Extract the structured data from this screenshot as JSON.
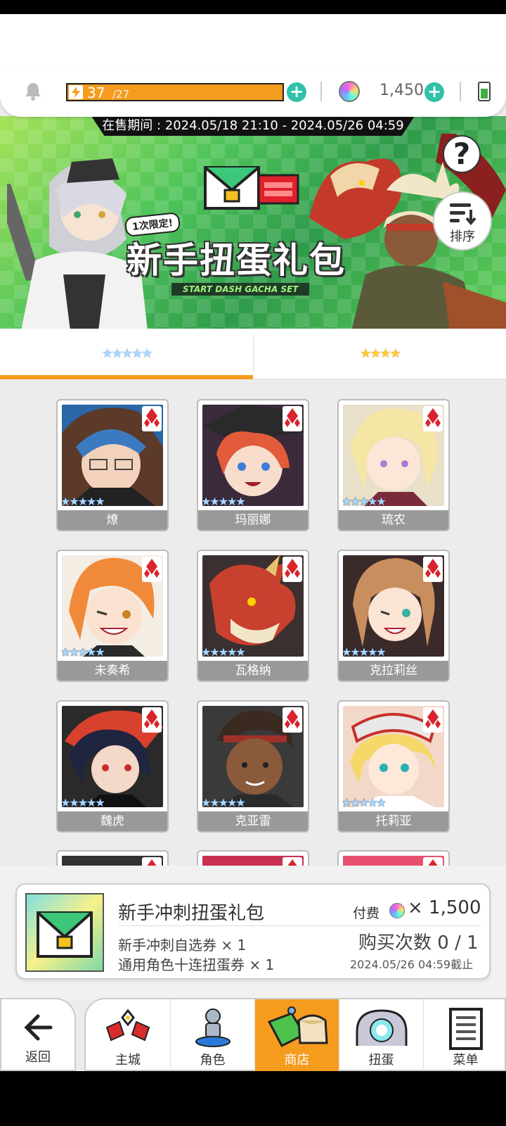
{
  "header": {
    "stamina_current": "37",
    "stamina_max": "/27",
    "gem_count": "1,450"
  },
  "banner": {
    "sale_period": "在售期间 : 2024.05/18 21:10 - 2024.05/26 04:59",
    "limited_tag": "1次限定!",
    "title": "新手扭蛋礼包",
    "subtitle": "START DASH GACHA SET",
    "help_label": "?",
    "sort_label": "排序"
  },
  "tabs": [
    {
      "label": "★★★★★",
      "rarity": 5,
      "selected": true
    },
    {
      "label": "★★★★",
      "rarity": 4,
      "selected": false
    }
  ],
  "characters": [
    {
      "name": "燎",
      "stars": "★★★★★"
    },
    {
      "name": "玛丽娜",
      "stars": "★★★★★"
    },
    {
      "name": "琉农",
      "stars": "★★★★★"
    },
    {
      "name": "未奏希",
      "stars": "★★★★★"
    },
    {
      "name": "瓦格纳",
      "stars": "★★★★★"
    },
    {
      "name": "克拉莉丝",
      "stars": "★★★★★"
    },
    {
      "name": "魏虎",
      "stars": "★★★★★"
    },
    {
      "name": "克亚雷",
      "stars": "★★★★★"
    },
    {
      "name": "托莉亚",
      "stars": "★★★★★"
    }
  ],
  "package": {
    "title": "新手冲刺扭蛋礼包",
    "item1": "新手冲刺自选券 × 1",
    "item2": "通用角色十连扭蛋券 × 1",
    "pay_label": "付费",
    "price": "× 1,500",
    "purchase_count": "购买次数 0 / 1",
    "deadline": "2024.05/26 04:59截止"
  },
  "nav": {
    "back": "返回",
    "items": [
      {
        "label": "主城",
        "active": false
      },
      {
        "label": "角色",
        "active": false
      },
      {
        "label": "商店",
        "active": true
      },
      {
        "label": "扭蛋",
        "active": false
      },
      {
        "label": "菜单",
        "active": false
      }
    ]
  },
  "colors": {
    "accent_orange": "#f59b1e",
    "plus_teal": "#2fc2a9",
    "suit_red": "#d9232d"
  }
}
